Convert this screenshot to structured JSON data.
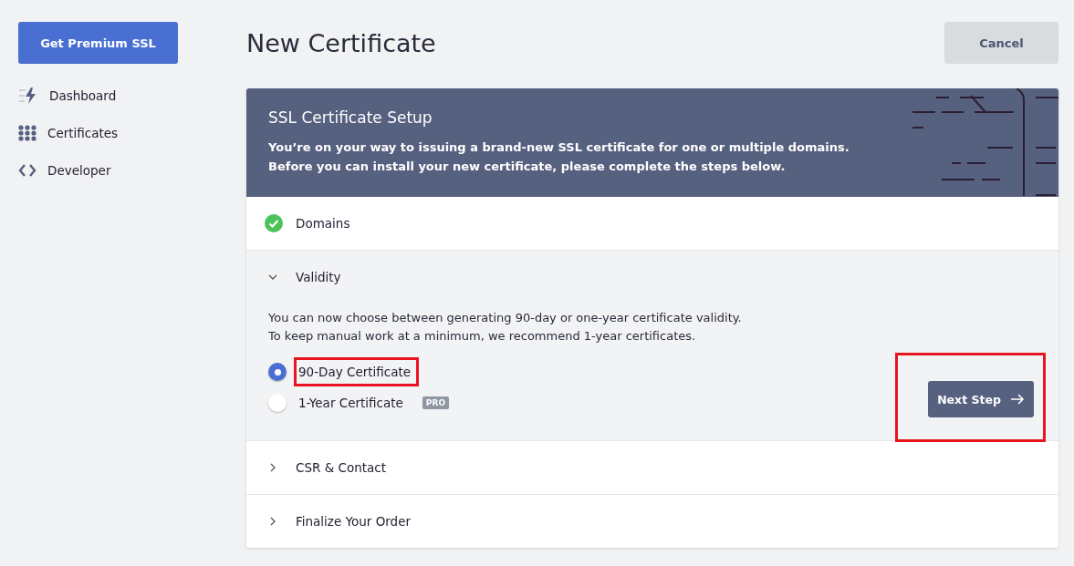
{
  "sidebar": {
    "premium_button": "Get Premium SSL",
    "items": [
      {
        "label": "Dashboard"
      },
      {
        "label": "Certificates"
      },
      {
        "label": "Developer"
      }
    ]
  },
  "page": {
    "title": "New Certificate",
    "cancel_button": "Cancel"
  },
  "setup": {
    "title": "SSL Certificate Setup",
    "description": [
      "You’re on your way to issuing a brand-new SSL certificate for one or multiple domains.",
      "Before you can install your new certificate, please complete the steps below."
    ]
  },
  "steps": [
    {
      "label": "Domains",
      "completed": true,
      "expanded": false
    },
    {
      "label": "Validity",
      "completed": false,
      "expanded": true,
      "text": [
        "You can now choose between generating 90-day or one-year certificate validity.",
        "To keep manual work at a minimum, we recommend 1-year certificates."
      ],
      "options": [
        {
          "label": "90-Day Certificate",
          "selected": true,
          "highlighted": true
        },
        {
          "label": "1-Year Certificate",
          "selected": false,
          "highlighted": false,
          "badge": "PRO"
        }
      ],
      "next_button": {
        "label": "Next Step",
        "highlighted": true
      }
    },
    {
      "label": "CSR & Contact",
      "completed": false,
      "expanded": false
    },
    {
      "label": "Finalize Your Order",
      "completed": false,
      "expanded": false
    }
  ]
}
